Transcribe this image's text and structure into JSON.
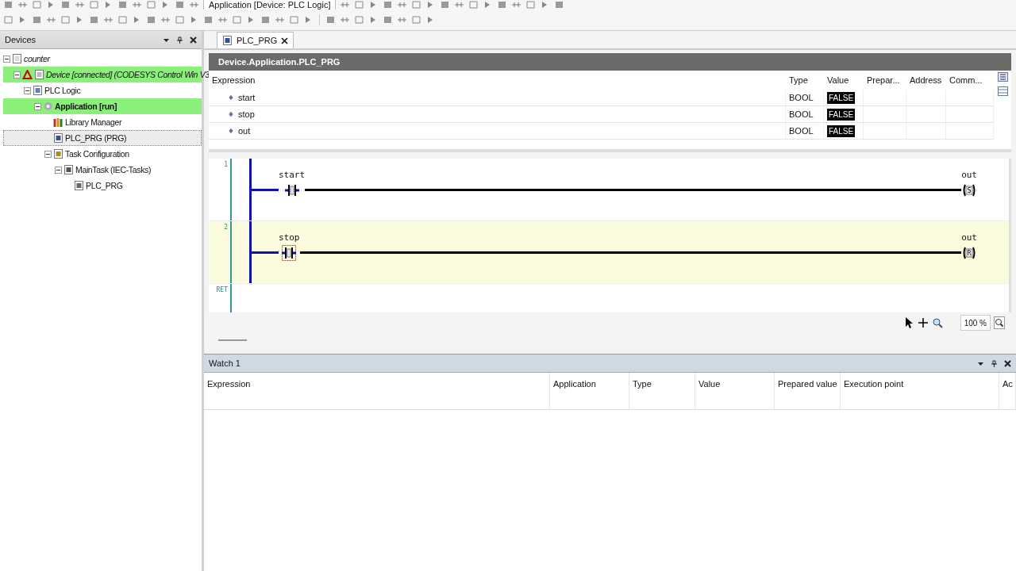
{
  "toolbar": {
    "application_combo": "Application [Device: PLC Logic]"
  },
  "devices_panel": {
    "title": "Devices",
    "tree": [
      {
        "label": "counter",
        "kind": "project",
        "expanded": true,
        "online": false,
        "selected": false,
        "children": [
          {
            "label": "Device [connected] (CODESYS Control Win V3",
            "kind": "device",
            "expanded": true,
            "online": true,
            "selected": false,
            "children": [
              {
                "label": "PLC Logic",
                "kind": "plc",
                "expanded": true,
                "online": false,
                "selected": false,
                "children": [
                  {
                    "label": "Application [run]",
                    "kind": "application",
                    "expanded": true,
                    "online": true,
                    "selected": false,
                    "children": [
                      {
                        "label": "Library Manager",
                        "kind": "library",
                        "online": false,
                        "selected": false
                      },
                      {
                        "label": "PLC_PRG (PRG)",
                        "kind": "pou",
                        "online": false,
                        "selected": true
                      },
                      {
                        "label": "Task Configuration",
                        "kind": "tasks",
                        "expanded": true,
                        "online": false,
                        "selected": false,
                        "children": [
                          {
                            "label": "MainTask (IEC-Tasks)",
                            "kind": "task",
                            "expanded": true,
                            "online": false,
                            "selected": false,
                            "children": [
                              {
                                "label": "PLC_PRG",
                                "kind": "call",
                                "online": false,
                                "selected": false
                              }
                            ]
                          }
                        ]
                      }
                    ]
                  }
                ]
              }
            ]
          }
        ]
      }
    ]
  },
  "editor": {
    "tabs": [
      {
        "label": "PLC_PRG",
        "selected": true
      }
    ],
    "path": "Device.Application.PLC_PRG",
    "variables": {
      "columns": [
        "Expression",
        "Type",
        "Value",
        "Prepar...",
        "Address",
        "Comm..."
      ],
      "rows": [
        {
          "expression": "start",
          "type": "BOOL",
          "value": "FALSE"
        },
        {
          "expression": "stop",
          "type": "BOOL",
          "value": "FALSE"
        },
        {
          "expression": "out",
          "type": "BOOL",
          "value": "FALSE"
        }
      ]
    },
    "rungs": [
      {
        "number": "1",
        "selected": false,
        "contact": {
          "variable": "start",
          "selected": false
        },
        "coil": {
          "variable": "out",
          "mark": "S"
        }
      },
      {
        "number": "2",
        "selected": true,
        "contact": {
          "variable": "stop",
          "selected": true
        },
        "coil": {
          "variable": "out",
          "mark": "R"
        }
      }
    ],
    "return_label": "RET",
    "zoom": "100 %"
  },
  "watch": {
    "title": "Watch 1",
    "columns": [
      "Expression",
      "Application",
      "Type",
      "Value",
      "Prepared value",
      "Execution point",
      "Ac"
    ]
  }
}
